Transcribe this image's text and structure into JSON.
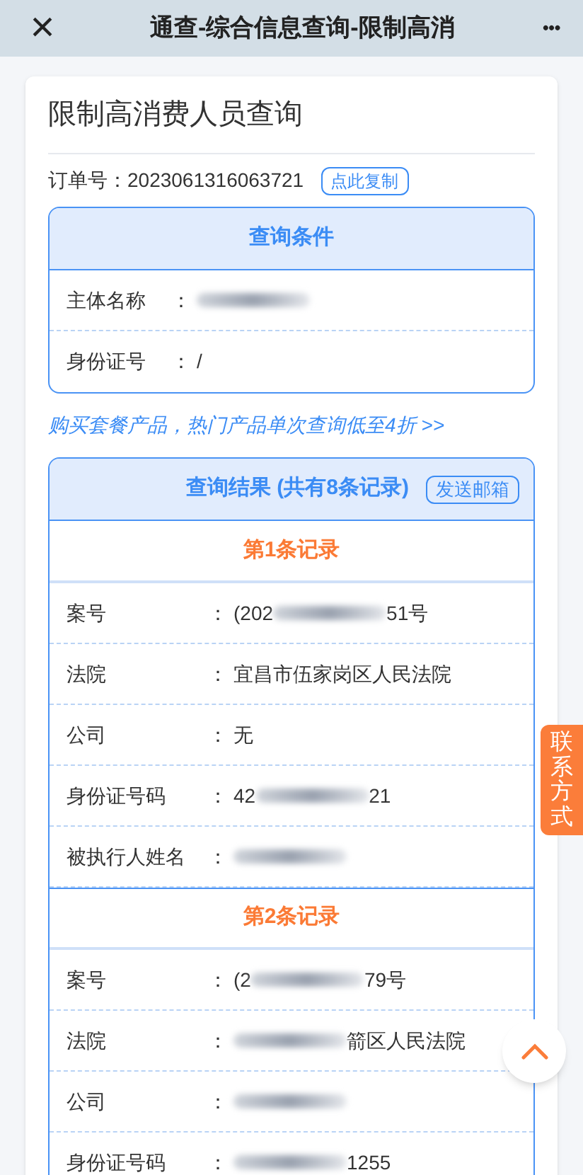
{
  "top_bar": {
    "close_icon": "×",
    "title": "通查-综合信息查询-限制高消",
    "more": "•••"
  },
  "page_title": "限制高消费人员查询",
  "order": {
    "label": "订单号：",
    "number": "2023061316063721",
    "copy_button": "点此复制"
  },
  "conditions": {
    "title": "查询条件",
    "rows": [
      {
        "label": "主体名称",
        "colon": "：",
        "redacted": true
      },
      {
        "label": "身份证号",
        "colon": "：",
        "value": "/",
        "redacted": false
      }
    ]
  },
  "promo_link": "购买套餐产品，热门产品单次查询低至4折 >>",
  "results": {
    "title": "查询结果 (共有8条记录)",
    "email_button": "发送邮箱",
    "records": [
      {
        "title": "第1条记录",
        "rows": [
          {
            "label": "案号",
            "colon": "：",
            "prefix": "(202",
            "suffix": "51号",
            "redacted": true
          },
          {
            "label": "法院",
            "colon": "：",
            "value": "宜昌市伍家岗区人民法院",
            "redacted": false
          },
          {
            "label": "公司",
            "colon": "：",
            "value": "无",
            "redacted": false
          },
          {
            "label": "身份证号码",
            "colon": "：",
            "prefix": "42",
            "suffix": "21",
            "redacted": true
          },
          {
            "label": "被执行人姓名",
            "colon": "：",
            "redacted": true
          }
        ]
      },
      {
        "title": "第2条记录",
        "rows": [
          {
            "label": "案号",
            "colon": "：",
            "prefix": "(2",
            "suffix": "79号",
            "redacted": true
          },
          {
            "label": "法院",
            "colon": "：",
            "suffix": "箭区人民法院",
            "redacted": true
          },
          {
            "label": "公司",
            "colon": "：",
            "redacted": true
          },
          {
            "label": "身份证号码",
            "colon": "：",
            "suffix": "1255",
            "redacted": true
          }
        ]
      }
    ]
  },
  "contact_tab": "联系方式"
}
